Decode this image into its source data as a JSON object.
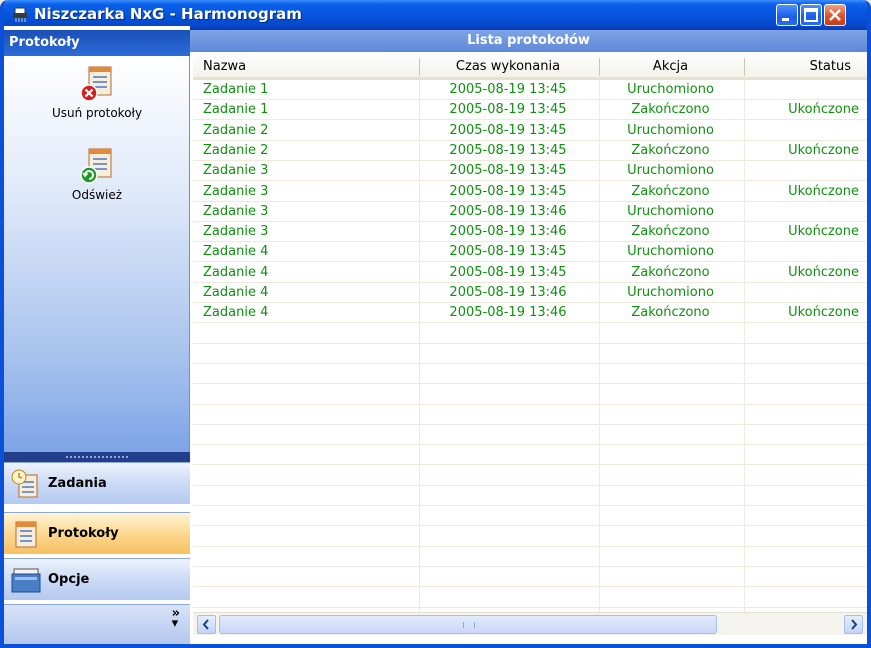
{
  "window": {
    "title": "Niszczarka NxG - Harmonogram"
  },
  "nav": {
    "header": "Protokoły",
    "actions": [
      {
        "label": "Usuń protokoły",
        "icon": "delete-logs-icon"
      },
      {
        "label": "Odśwież",
        "icon": "refresh-logs-icon"
      }
    ],
    "buttons": [
      {
        "label": "Zadania",
        "icon": "tasks-icon",
        "active": false
      },
      {
        "label": "Protokoły",
        "icon": "logs-icon",
        "active": true
      },
      {
        "label": "Opcje",
        "icon": "options-icon",
        "active": false
      }
    ],
    "more": "»"
  },
  "main": {
    "header": "Lista protokołów",
    "columns": [
      "Nazwa",
      "Czas wykonania",
      "Akcja",
      "Status"
    ],
    "rows": [
      [
        "Zadanie 1",
        "2005-08-19 13:45",
        "Uruchomiono",
        ""
      ],
      [
        "Zadanie 1",
        "2005-08-19 13:45",
        "Zakończono",
        "Ukończone"
      ],
      [
        "Zadanie 2",
        "2005-08-19 13:45",
        "Uruchomiono",
        ""
      ],
      [
        "Zadanie 2",
        "2005-08-19 13:45",
        "Zakończono",
        "Ukończone"
      ],
      [
        "Zadanie 3",
        "2005-08-19 13:45",
        "Uruchomiono",
        ""
      ],
      [
        "Zadanie 3",
        "2005-08-19 13:45",
        "Zakończono",
        "Ukończone"
      ],
      [
        "Zadanie 3",
        "2005-08-19 13:46",
        "Uruchomiono",
        ""
      ],
      [
        "Zadanie 3",
        "2005-08-19 13:46",
        "Zakończono",
        "Ukończone"
      ],
      [
        "Zadanie 4",
        "2005-08-19 13:45",
        "Uruchomiono",
        ""
      ],
      [
        "Zadanie 4",
        "2005-08-19 13:45",
        "Zakończono",
        "Ukończone"
      ],
      [
        "Zadanie 4",
        "2005-08-19 13:46",
        "Uruchomiono",
        ""
      ],
      [
        "Zadanie 4",
        "2005-08-19 13:46",
        "Zakończono",
        "Ukończone"
      ]
    ],
    "row_text_color": "#109010"
  },
  "colors": {
    "titlebar": "#0654dc",
    "nav_header": "#1a4fb8",
    "active_button": "#fbd58a"
  }
}
